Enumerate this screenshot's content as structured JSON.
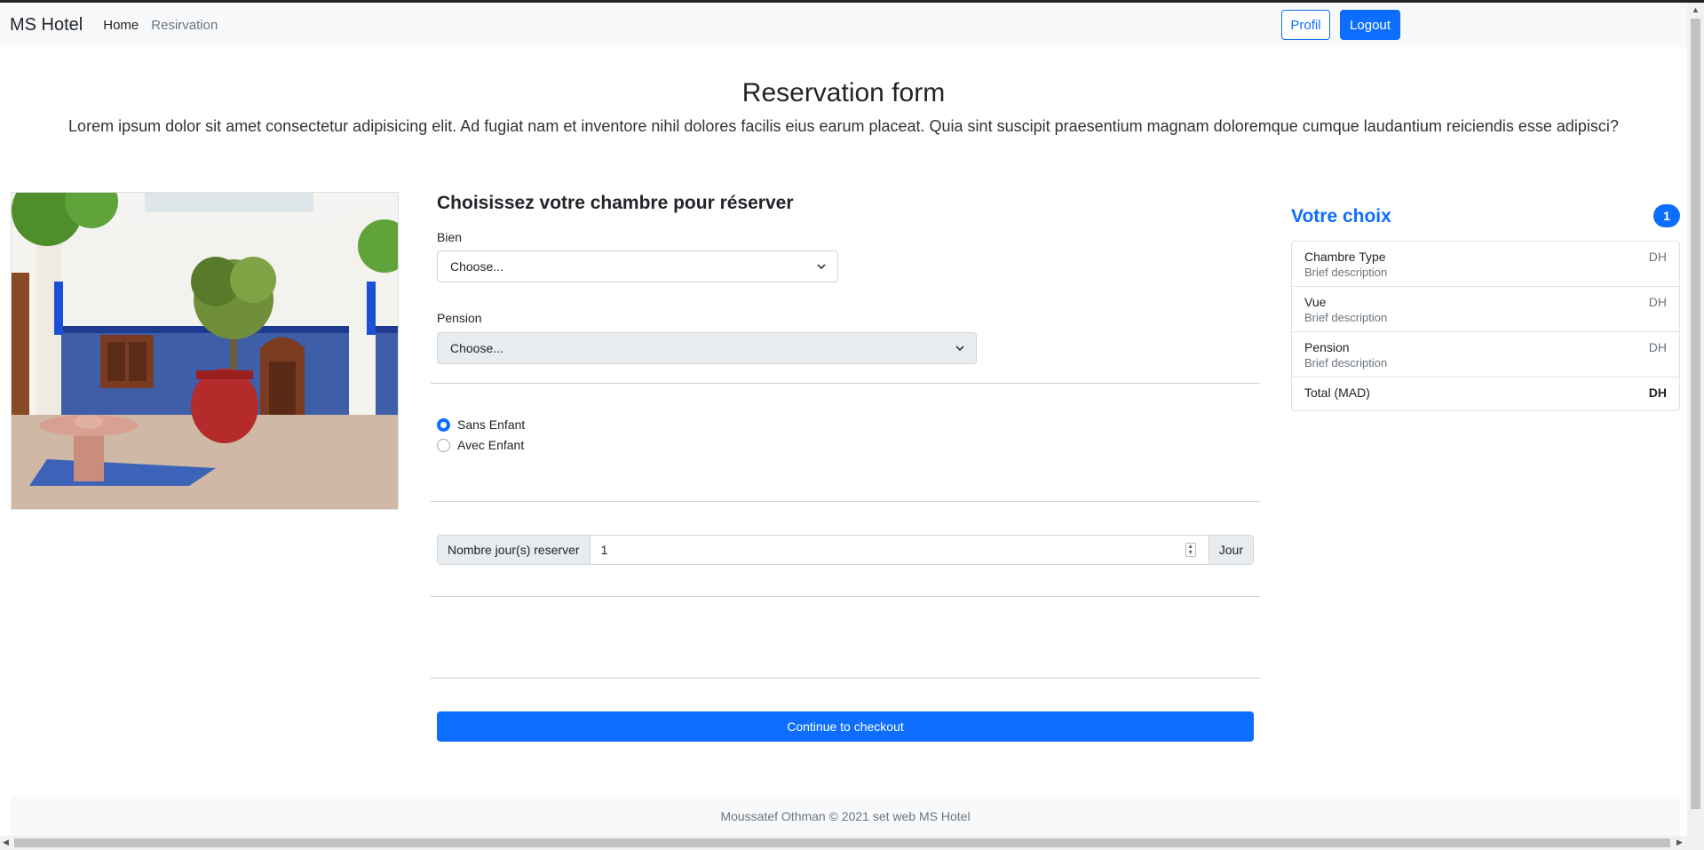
{
  "navbar": {
    "brand": "MS Hotel",
    "links": [
      "Home",
      "Resirvation"
    ],
    "profil_label": "Profil",
    "logout_label": "Logout"
  },
  "hero": {
    "title": "Reservation form",
    "lead": "Lorem ipsum dolor sit amet consectetur adipisicing elit. Ad fugiat nam et inventore nihil dolores facilis eius earum placeat. Quia sint suscipit praesentium magnam doloremque cumque laudantium reiciendis esse adipisci?"
  },
  "form": {
    "heading": "Choisissez votre chambre pour réserver",
    "bien_label": "Bien",
    "bien_value": "Choose...",
    "pension_label": "Pension",
    "pension_value": "Choose...",
    "radios": [
      {
        "label": "Sans Enfant",
        "checked": true
      },
      {
        "label": "Avec Enfant",
        "checked": false
      }
    ],
    "days_prefix": "Nombre jour(s) reserver",
    "days_value": "1",
    "days_suffix": "Jour",
    "checkout_label": "Continue to checkout"
  },
  "summary": {
    "title": "Votre choix",
    "count": "1",
    "items": [
      {
        "title": "Chambre Type",
        "desc": "Brief description",
        "price": "DH"
      },
      {
        "title": "Vue",
        "desc": "Brief description",
        "price": "DH"
      },
      {
        "title": "Pension",
        "desc": "Brief description",
        "price": "DH"
      }
    ],
    "total_label": "Total (MAD)",
    "total_value": "DH"
  },
  "footer": {
    "text": "Moussatef Othman © 2021 set web MS Hotel"
  },
  "colors": {
    "primary": "#0d6efd",
    "navbar_bg": "#f8f9fa"
  }
}
